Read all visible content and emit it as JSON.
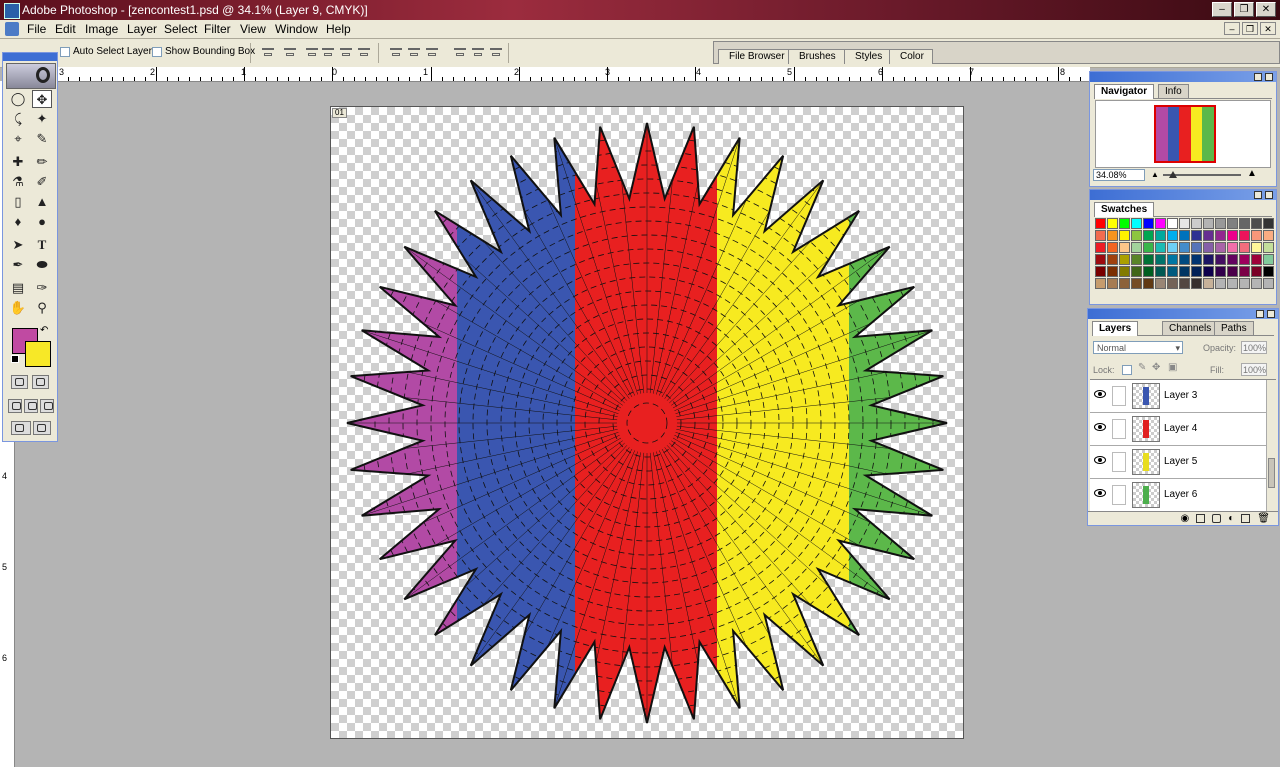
{
  "window": {
    "title": "Adobe Photoshop - [zencontest1.psd @ 34.1% (Layer 9, CMYK)]"
  },
  "menu": [
    "File",
    "Edit",
    "Image",
    "Layer",
    "Select",
    "Filter",
    "View",
    "Window",
    "Help"
  ],
  "options": {
    "auto_select": "Auto Select Layer",
    "show_bounding": "Show Bounding Box"
  },
  "palette_well": [
    "File Browser",
    "Brushes",
    "Styles",
    "Color"
  ],
  "rulers": {
    "top": [
      "3",
      "2",
      "1",
      "0",
      "1",
      "2",
      "3",
      "4",
      "5",
      "6",
      "7",
      "8"
    ],
    "left": [
      "4",
      "5",
      "6"
    ]
  },
  "colors": {
    "foreground": "#c04aa2",
    "background": "#f7e827"
  },
  "document": {
    "badge": "01"
  },
  "navigator": {
    "tabs": [
      "Navigator",
      "Info"
    ],
    "zoom": "34.08%"
  },
  "swatches": {
    "tab": "Swatches",
    "colors": [
      "#ff0000",
      "#ffff00",
      "#00ff00",
      "#00ffff",
      "#0000ff",
      "#ff00ff",
      "#ffffff",
      "#e6e6e6",
      "#cccccc",
      "#b3b3b3",
      "#999999",
      "#808080",
      "#666666",
      "#4d4d4d",
      "#333333",
      "#f26c4f",
      "#f7941d",
      "#fff200",
      "#8dc63f",
      "#00a651",
      "#00a99d",
      "#00aeef",
      "#0072bc",
      "#2e3192",
      "#662d91",
      "#92278f",
      "#ec008c",
      "#ed145b",
      "#f7977a",
      "#fbad82",
      "#ed1c24",
      "#f26522",
      "#fdc689",
      "#a3d39c",
      "#39b54a",
      "#1cbbb4",
      "#6dcff6",
      "#448ccb",
      "#5674b9",
      "#8560a8",
      "#a864a8",
      "#f06eaa",
      "#f26d7d",
      "#fff799",
      "#c4df9b",
      "#9e0b0f",
      "#a0410d",
      "#aba000",
      "#598527",
      "#007236",
      "#00746b",
      "#0076a3",
      "#004a80",
      "#003471",
      "#1b1464",
      "#440e62",
      "#630460",
      "#9e005d",
      "#9e0039",
      "#82ca9c",
      "#790000",
      "#7b2e00",
      "#827b00",
      "#406618",
      "#005e20",
      "#005952",
      "#005b7f",
      "#003663",
      "#002157",
      "#0d004c",
      "#32004b",
      "#4b0049",
      "#7b0046",
      "#7a0026",
      "#000000",
      "#c69c6d",
      "#a67c52",
      "#8c6239",
      "#754c24",
      "#603913",
      "#998675",
      "#736357",
      "#534741",
      "#362f2d",
      "#c7b299",
      "#b4b4b4",
      "#b4b4b4",
      "#b4b4b4",
      "#b4b4b4",
      "#b4b4b4"
    ]
  },
  "layers_panel": {
    "tabs": [
      "Layers",
      "Channels",
      "Paths"
    ],
    "blend_mode": "Normal",
    "opacity_label": "Opacity:",
    "opacity_value": "100%",
    "lock_label": "Lock:",
    "fill_label": "Fill:",
    "fill_value": "100%",
    "layers": [
      {
        "name": "Layer 3",
        "color": "#3a56b0"
      },
      {
        "name": "Layer 4",
        "color": "#e02020"
      },
      {
        "name": "Layer 5",
        "color": "#e8dd20"
      },
      {
        "name": "Layer 6",
        "color": "#4cae4c"
      }
    ]
  },
  "artwork": {
    "bands": [
      "#b24aa5",
      "#3a56b0",
      "#e82020",
      "#f7ea20",
      "#5cb84a"
    ]
  }
}
